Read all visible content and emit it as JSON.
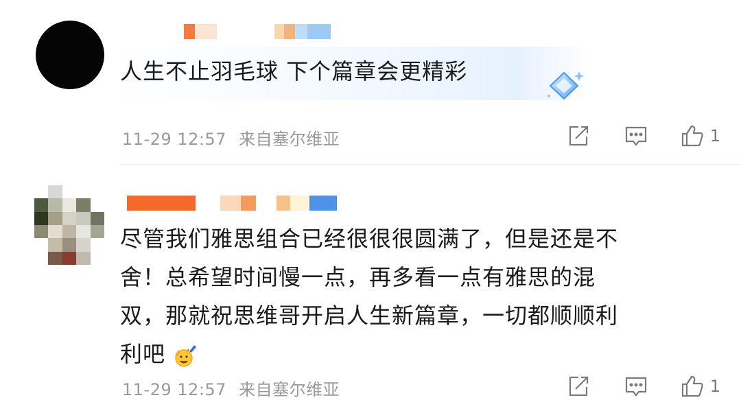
{
  "comments": [
    {
      "text": "人生不止羽毛球 下个篇章会更精彩",
      "time": "11-29 12:57",
      "location": "来自塞尔维亚",
      "like_count": "1",
      "badge_icon": "diamond-sparkle-icon"
    },
    {
      "text_lines": [
        "尽管我们雅思组合已经很很很圆满了，但是还是不",
        "舍！总希望时间慢一点，再多看一点有雅思的混",
        "双，那就祝思维哥开启人生新篇章，一切都顺顺利",
        "利吧"
      ],
      "emoji": "cheering-emoji",
      "time": "11-29 12:57",
      "location": "来自塞尔维亚",
      "like_count": "1"
    }
  ],
  "icons": {
    "share": "share-icon",
    "reply": "comment-icon",
    "like": "thumbs-up-icon"
  },
  "colors": {
    "meta_text": "#9a9a9a",
    "icon_gray": "#7a7a7a",
    "accent_blue": "#5aa8f5"
  }
}
